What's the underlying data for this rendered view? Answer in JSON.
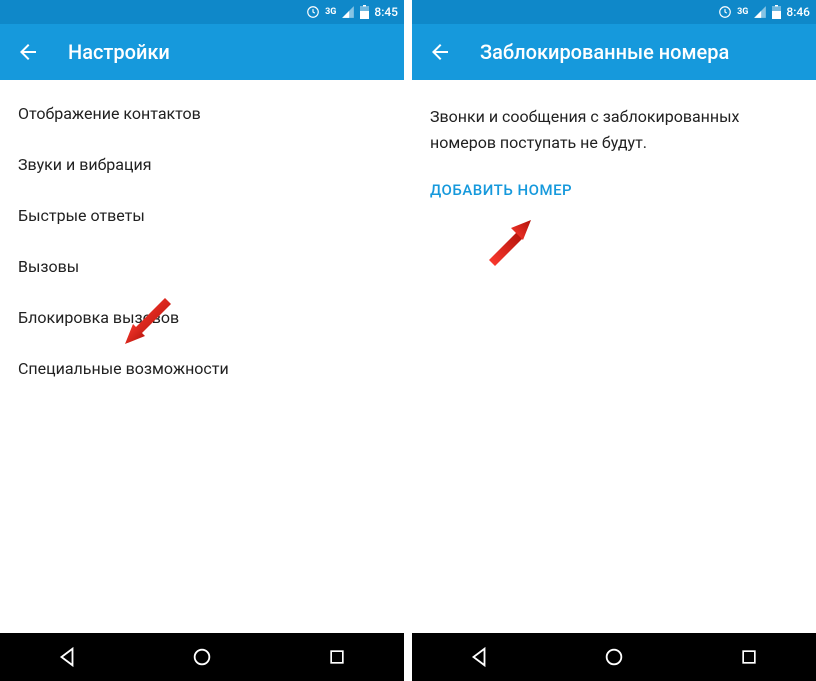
{
  "left": {
    "status": {
      "network": "3G",
      "time": "8:45"
    },
    "appbar": {
      "title": "Настройки"
    },
    "items": [
      "Отображение контактов",
      "Звуки и вибрация",
      "Быстрые ответы",
      "Вызовы",
      "Блокировка вызовов",
      "Специальные возможности"
    ]
  },
  "right": {
    "status": {
      "network": "3G",
      "time": "8:46"
    },
    "appbar": {
      "title": "Заблокированные номера"
    },
    "description": "Звонки и сообщения с заблокированных номеров поступать не будут.",
    "action": "ДОБАВИТЬ НОМЕР"
  }
}
